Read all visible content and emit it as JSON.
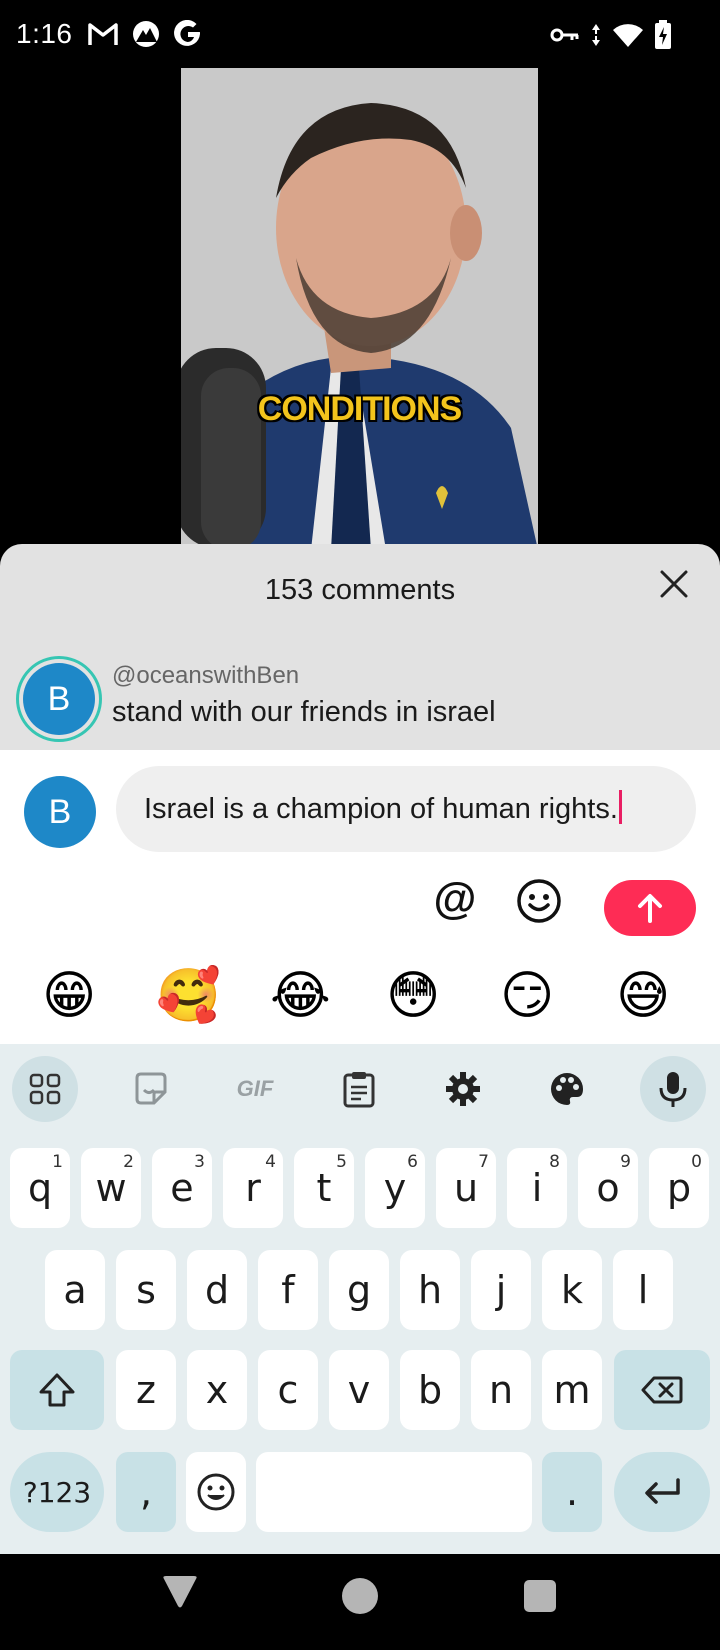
{
  "status_bar": {
    "time": "1:16",
    "left_icons": [
      "gmail-icon",
      "app-icon",
      "google-icon"
    ],
    "right_icons": [
      "vpn-key-icon",
      "data-arrows-icon",
      "wifi-icon",
      "battery-charging-icon"
    ]
  },
  "video": {
    "caption": "CONDITIONS"
  },
  "comments": {
    "title": "153 comments",
    "items": [
      {
        "avatar_letter": "B",
        "username": "@oceanswithBen",
        "text": "stand with our friends in israel"
      }
    ]
  },
  "composer": {
    "avatar_letter": "B",
    "value": "Israel is a champion of human rights.",
    "at_label": "@",
    "accent_color": "#fe2c55",
    "quick_emojis": [
      "😁",
      "🥰",
      "😂",
      "😳",
      "😏",
      "😅"
    ]
  },
  "keyboard": {
    "toolbar": {
      "gif_label": "GIF",
      "icons": [
        "apps-grid-icon",
        "sticker-icon",
        "gif-icon",
        "clipboard-icon",
        "settings-icon",
        "palette-icon",
        "microphone-icon"
      ]
    },
    "row1": [
      {
        "k": "q",
        "h": "1"
      },
      {
        "k": "w",
        "h": "2"
      },
      {
        "k": "e",
        "h": "3"
      },
      {
        "k": "r",
        "h": "4"
      },
      {
        "k": "t",
        "h": "5"
      },
      {
        "k": "y",
        "h": "6"
      },
      {
        "k": "u",
        "h": "7"
      },
      {
        "k": "i",
        "h": "8"
      },
      {
        "k": "o",
        "h": "9"
      },
      {
        "k": "p",
        "h": "0"
      }
    ],
    "row2": [
      "a",
      "s",
      "d",
      "f",
      "g",
      "h",
      "j",
      "k",
      "l"
    ],
    "row3": [
      "z",
      "x",
      "c",
      "v",
      "b",
      "n",
      "m"
    ],
    "symbols_label": "?123",
    "comma_label": ",",
    "period_label": "."
  }
}
